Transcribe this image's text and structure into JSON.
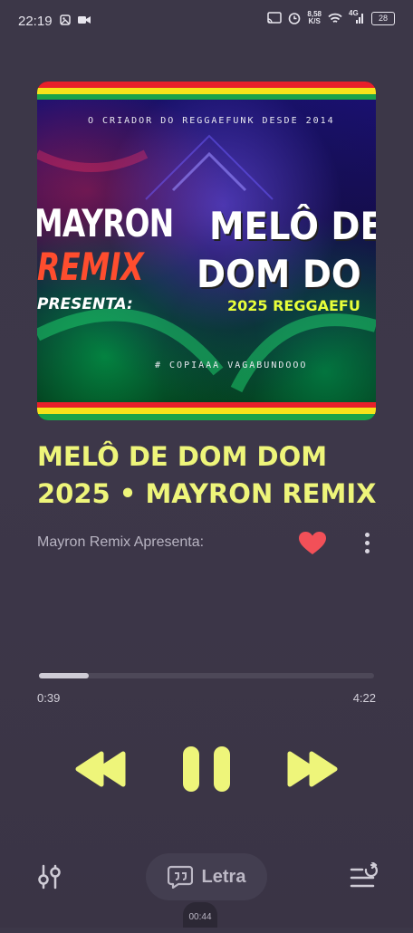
{
  "status_bar": {
    "time": "22:19",
    "net_speed_value": "8,58",
    "net_speed_unit": "K/S",
    "network": "4G",
    "battery": "28",
    "icons": [
      "gallery-icon",
      "video-camera-icon",
      "cast-icon",
      "alarm-icon",
      "wifi-icon",
      "signal-icon",
      "battery-icon"
    ]
  },
  "album_art": {
    "top_text": "O CRIADOR DO REGGAEFUNK DESDE 2014",
    "artist_line1": "MAYRON",
    "artist_line2": "REMIX",
    "presenta": "PRESENTA:",
    "title_line1": "MELÔ DE",
    "title_line2": "DOM DO",
    "subtitle": "2025 REGGAEFU",
    "bottom_text": "# COPIAAA VAGABUNDOOO",
    "stripe_colors": [
      "#e8202a",
      "#f6e31b",
      "#1aa34a"
    ]
  },
  "track": {
    "title": "MELÔ DE DOM DOM 2025 • MAYRON REMIX",
    "artist": "Mayron Remix Apresenta:",
    "liked": true
  },
  "progress": {
    "elapsed": "0:39",
    "total": "4:22",
    "fraction": 0.149
  },
  "controls": {
    "accent": "#eef57a",
    "buttons": [
      "previous-button",
      "pause-button",
      "next-button"
    ]
  },
  "bottom_bar": {
    "lyrics_label": "Letra",
    "video_time": "00:44"
  }
}
